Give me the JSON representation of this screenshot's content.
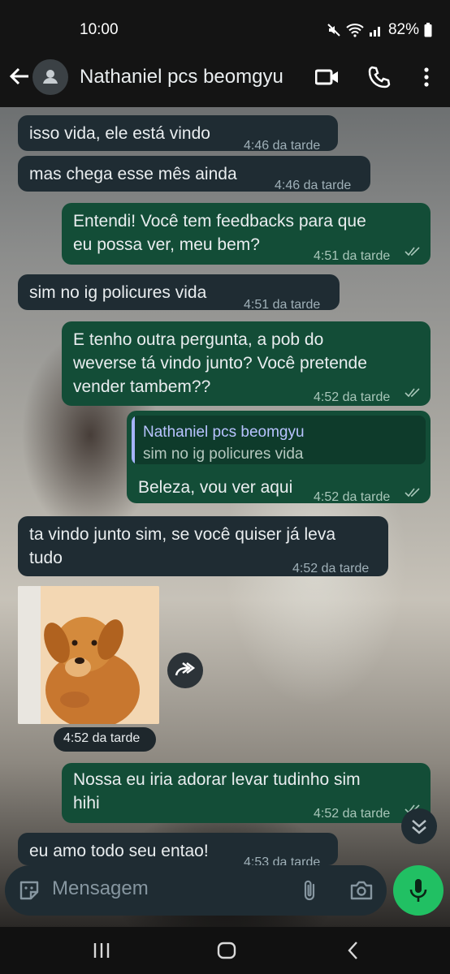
{
  "status": {
    "time": "10:00",
    "battery": "82%"
  },
  "header": {
    "contact_name": "Nathaniel pcs beomgyu"
  },
  "messages": [
    {
      "text": "isso vida, ele está vindo",
      "time": "4:46 da tarde"
    },
    {
      "text": "mas chega esse mês ainda",
      "time": "4:46 da tarde"
    },
    {
      "lines": [
        "Entendi! Você tem feedbacks para que",
        "eu possa ver, meu bem?"
      ],
      "time": "4:51 da tarde"
    },
    {
      "text": "sim no ig policures vida",
      "time": "4:51 da tarde"
    },
    {
      "lines": [
        "E tenho outra pergunta, a pob do",
        "weverse tá vindo junto? Você pretende",
        "vender tambem??"
      ],
      "time": "4:52 da tarde"
    },
    {
      "reply": {
        "name": "Nathaniel pcs beomgyu",
        "text": "sim no ig policures vida"
      },
      "text": "Beleza, vou ver aqui",
      "time": "4:52 da tarde"
    },
    {
      "lines": [
        "ta vindo junto sim, se você quiser já leva",
        "tudo"
      ],
      "time": "4:52 da tarde"
    },
    {
      "image": "puppy-photo",
      "time": "4:52 da tarde"
    },
    {
      "lines": [
        "Nossa eu iria adorar levar tudinho sim",
        "hihi"
      ],
      "time": "4:52 da tarde"
    },
    {
      "text": "eu amo todo seu entao!",
      "time": "4:53 da tarde"
    }
  ],
  "composer": {
    "placeholder": "Mensagem"
  },
  "colors": {
    "incoming": "#1f2c33",
    "outgoing": "#134d37",
    "accent": "#21c063"
  }
}
